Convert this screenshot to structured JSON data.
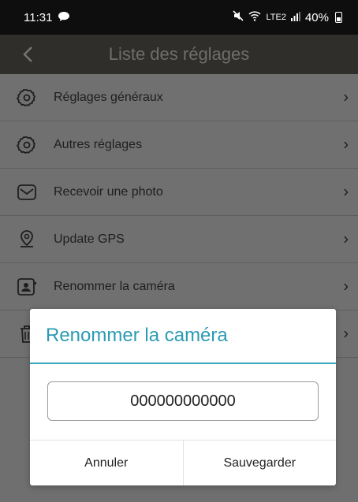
{
  "status_bar": {
    "time": "11:31",
    "network_small": "LTE2",
    "battery": "40%"
  },
  "header": {
    "title": "Liste des réglages",
    "back_icon": "chevron-left-icon"
  },
  "settings": {
    "items": [
      {
        "label": "Réglages généraux",
        "icon": "gear-icon"
      },
      {
        "label": "Autres réglages",
        "icon": "gear-icon"
      },
      {
        "label": "Recevoir une photo",
        "icon": "envelope-icon"
      },
      {
        "label": "Update GPS",
        "icon": "location-pin-icon"
      },
      {
        "label": "Renommer la caméra",
        "icon": "contact-card-icon"
      },
      {
        "label": "",
        "icon": "trash-icon"
      }
    ]
  },
  "dialog": {
    "title": "Renommer la caméra",
    "input_value": "000000000000",
    "cancel_label": "Annuler",
    "save_label": "Sauvegarder"
  },
  "colors": {
    "accent": "#2b9bb3",
    "overlay": "#6f6f6f",
    "header_bg": "#2f2e2b"
  }
}
